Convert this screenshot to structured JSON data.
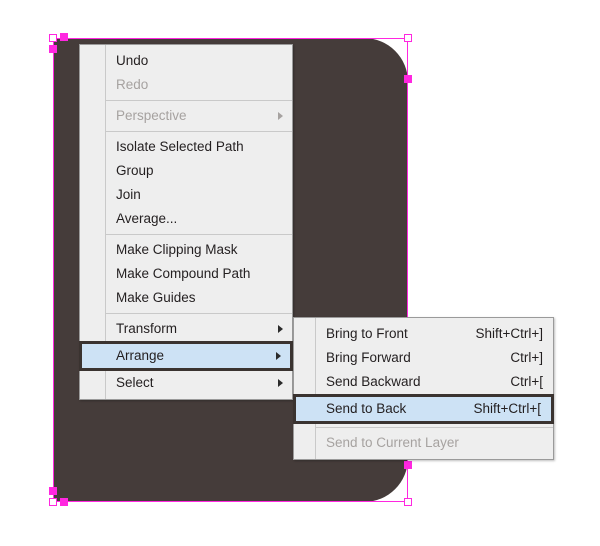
{
  "canvas": {
    "shape_name": "rounded-rectangle-path",
    "fill_color": "#453c3a",
    "selection_color": "#ff27e0"
  },
  "context_menu": {
    "name": "context-menu",
    "groups": [
      {
        "items": [
          {
            "label": "Undo",
            "accel": "",
            "disabled": false,
            "submenu": false
          },
          {
            "label": "Redo",
            "accel": "",
            "disabled": true,
            "submenu": false
          }
        ]
      },
      {
        "items": [
          {
            "label": "Perspective",
            "accel": "",
            "disabled": true,
            "submenu": true
          }
        ]
      },
      {
        "items": [
          {
            "label": "Isolate Selected Path",
            "accel": "",
            "disabled": false,
            "submenu": false
          },
          {
            "label": "Group",
            "accel": "",
            "disabled": false,
            "submenu": false
          },
          {
            "label": "Join",
            "accel": "",
            "disabled": false,
            "submenu": false
          },
          {
            "label": "Average...",
            "accel": "",
            "disabled": false,
            "submenu": false
          }
        ]
      },
      {
        "items": [
          {
            "label": "Make Clipping Mask",
            "accel": "",
            "disabled": false,
            "submenu": false
          },
          {
            "label": "Make Compound Path",
            "accel": "",
            "disabled": false,
            "submenu": false
          },
          {
            "label": "Make Guides",
            "accel": "",
            "disabled": false,
            "submenu": false
          }
        ]
      },
      {
        "items": [
          {
            "label": "Transform",
            "accel": "",
            "disabled": false,
            "submenu": true,
            "highlighted": false
          },
          {
            "label": "Arrange",
            "accel": "",
            "disabled": false,
            "submenu": true,
            "highlighted": true
          },
          {
            "label": "Select",
            "accel": "",
            "disabled": false,
            "submenu": true,
            "highlighted": false
          }
        ]
      }
    ]
  },
  "arrange_submenu": {
    "name": "arrange-submenu",
    "groups": [
      {
        "items": [
          {
            "label": "Bring to Front",
            "accel": "Shift+Ctrl+]",
            "disabled": false,
            "highlighted": false
          },
          {
            "label": "Bring Forward",
            "accel": "Ctrl+]",
            "disabled": false,
            "highlighted": false
          },
          {
            "label": "Send Backward",
            "accel": "Ctrl+[",
            "disabled": false,
            "highlighted": false
          },
          {
            "label": "Send to Back",
            "accel": "Shift+Ctrl+[",
            "disabled": false,
            "highlighted": true
          }
        ]
      },
      {
        "items": [
          {
            "label": "Send to Current Layer",
            "accel": "",
            "disabled": true,
            "highlighted": false
          }
        ]
      }
    ]
  },
  "colors": {
    "menu_background": "#eeeeee",
    "menu_border": "#9a9a9a",
    "highlight_fill": "#cde2f5",
    "highlight_border": "#3a3330",
    "disabled_text": "#a6a2a0",
    "text": "#231f20"
  }
}
